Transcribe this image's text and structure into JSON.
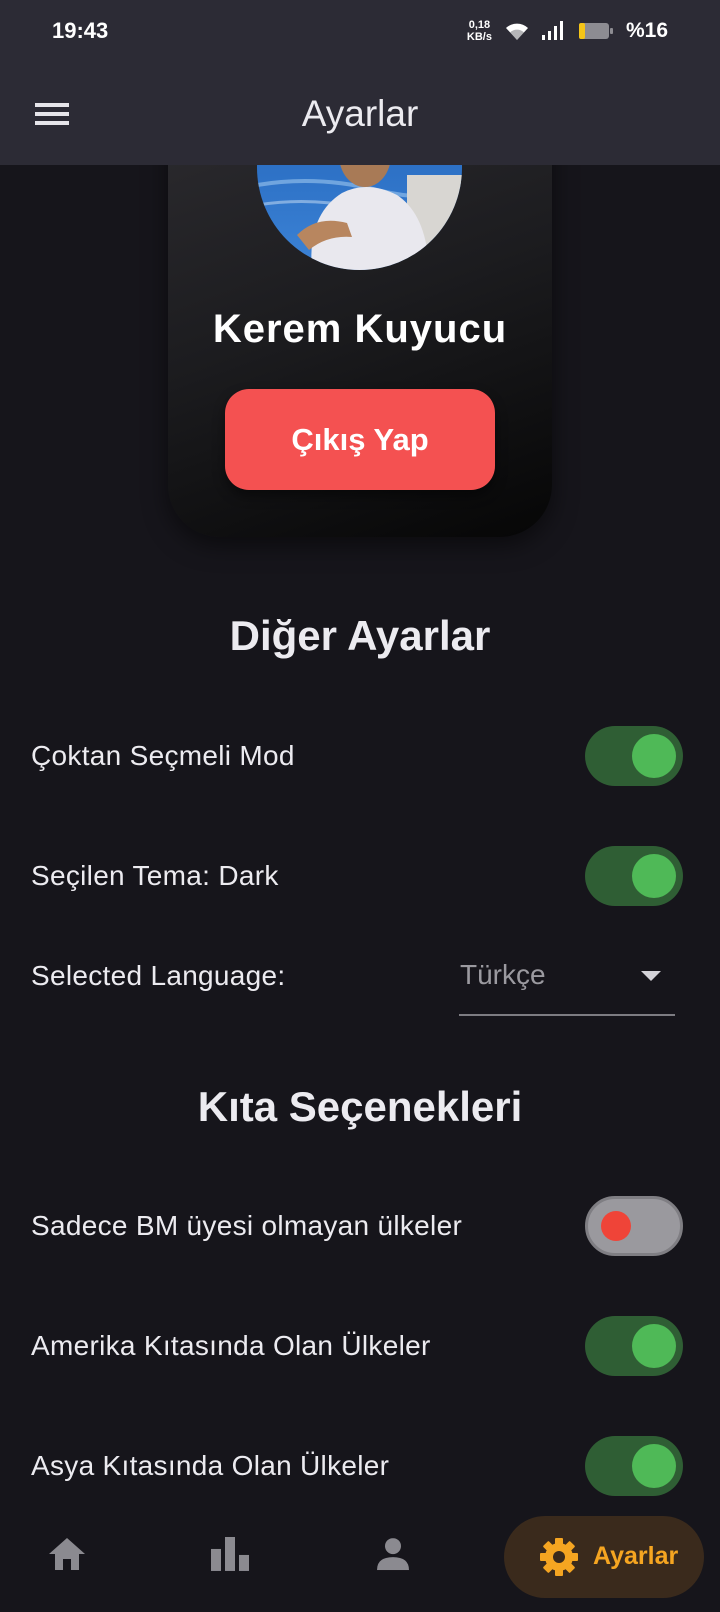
{
  "status_bar": {
    "time": "19:43",
    "net_speed_value": "0,18",
    "net_speed_unit": "KB/s",
    "battery_percent": "%16"
  },
  "app_bar": {
    "title": "Ayarlar",
    "menu_icon": "menu-icon"
  },
  "profile": {
    "name": "Kerem Kuyucu",
    "logout_label": "Çıkış Yap"
  },
  "other_settings": {
    "title": "Diğer Ayarlar",
    "multiple_choice_label": "Çoktan Seçmeli Mod",
    "multiple_choice_on": true,
    "theme_label": "Seçilen Tema: Dark",
    "theme_on": true,
    "language_label": "Selected Language:",
    "language_value": "Türkçe"
  },
  "continent_options": {
    "title": "Kıta Seçenekleri",
    "items": [
      {
        "label": "Sadece BM üyesi olmayan ülkeler",
        "on": false
      },
      {
        "label": "Amerika Kıtasında Olan Ülkeler",
        "on": true
      },
      {
        "label": "Asya Kıtasında Olan Ülkeler",
        "on": true
      }
    ]
  },
  "bottom_nav": {
    "items": [
      {
        "icon": "home-icon"
      },
      {
        "icon": "bar-chart-icon"
      },
      {
        "icon": "person-icon"
      },
      {
        "icon": "gear-icon",
        "label": "Ayarlar",
        "active": true
      }
    ]
  },
  "colors": {
    "accent": "#f5a521",
    "logout": "#f45151",
    "switch_on": "#4fb957",
    "switch_off_thumb": "#ef4438"
  }
}
